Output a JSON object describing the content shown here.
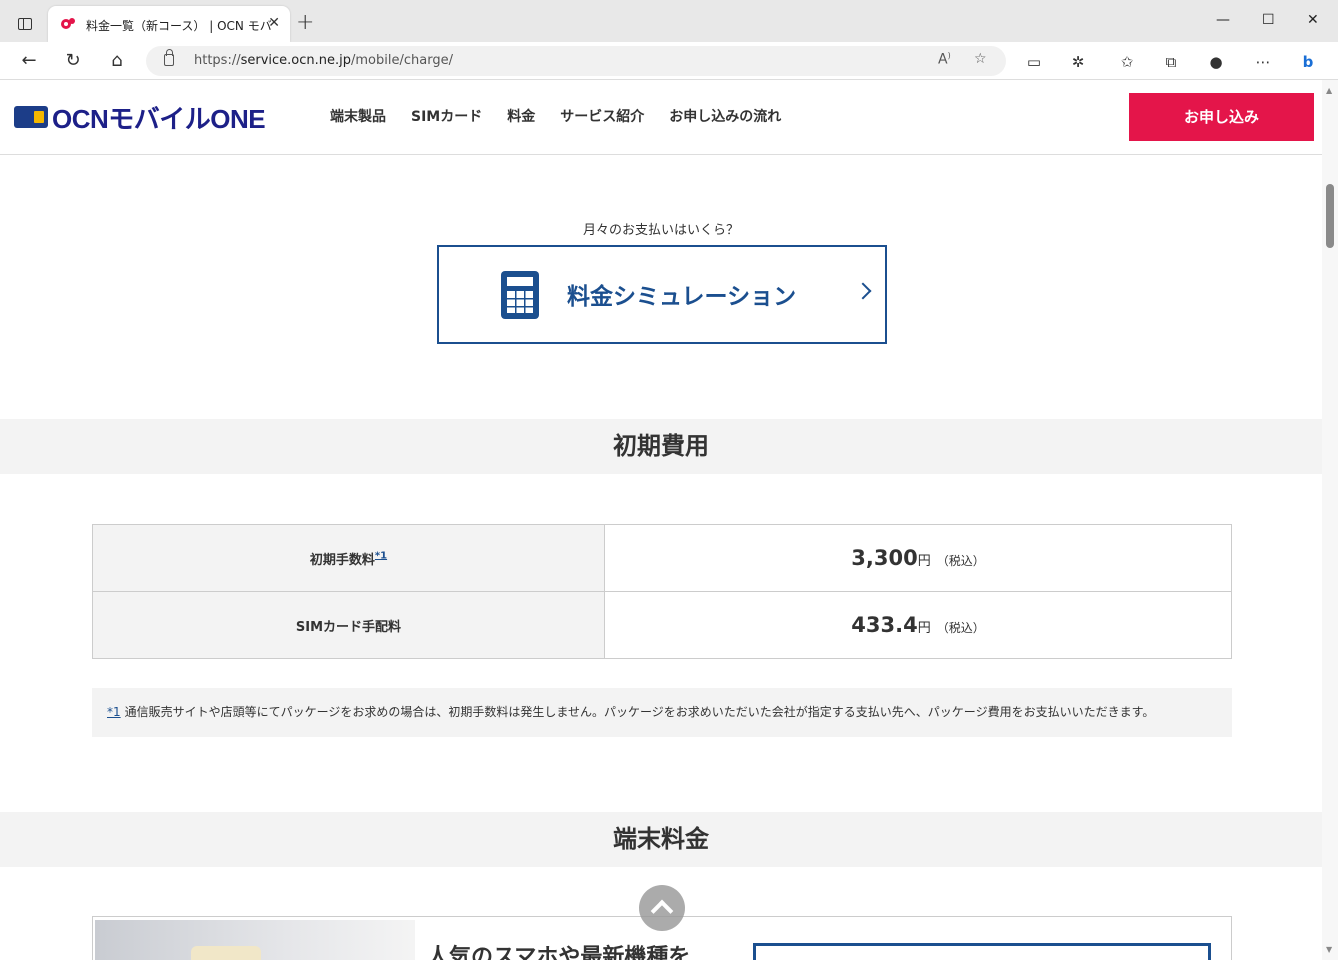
{
  "browser": {
    "tab_title": "料金一覧（新コース） | OCN モバイル ONE",
    "tab_close": "✕",
    "new_tab": "+",
    "window_controls": {
      "minimize": "—",
      "maximize": "☐",
      "close": "✕"
    },
    "url_prefix": "https://",
    "url_host": "service.ocn.ne.jp",
    "url_path": "/mobile/charge/"
  },
  "site": {
    "logo_text": "OCNモバイルONE",
    "nav": [
      "端末製品",
      "SIMカード",
      "料金",
      "サービス紹介",
      "お申し込みの流れ"
    ],
    "apply_label": "お申し込み"
  },
  "simulation": {
    "lead": "月々のお支払いはいくら？",
    "label": "料金シミュレーション"
  },
  "initial_cost": {
    "heading": "初期費用",
    "rows": [
      {
        "label": "初期手数料",
        "ref": "*1",
        "value": "3,300",
        "unit": "円",
        "tax": "（税込）"
      },
      {
        "label": "SIMカード手配料",
        "value": "433.4",
        "unit": "円",
        "tax": "（税込）"
      }
    ],
    "note_ref": "*1",
    "note_text": "通信販売サイトや店頭等にてパッケージをお求めの場合は、初期手数料は発生しません。パッケージをお求めいただいた会社が指定する支払い先へ、パッケージ費用をお支払いいただきます。"
  },
  "device_cost": {
    "heading": "端末料金",
    "promo_title": "人気のスマホや最新機種を"
  },
  "colors": {
    "brand_blue": "#1b4f8f",
    "apply_red": "#e4154a",
    "band_gray": "#f3f3f3"
  }
}
